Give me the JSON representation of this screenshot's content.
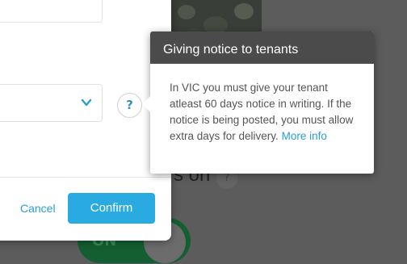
{
  "background": {
    "status_text": "s on",
    "help_glyph": "?",
    "toggle_label": "ON"
  },
  "modal": {
    "help_glyph": "?",
    "chevron_icon": "chevron-down-icon",
    "cancel_label": "Cancel",
    "confirm_label": "Confirm"
  },
  "tooltip": {
    "title": "Giving notice to tenants",
    "body_text": "In VIC you must give your tenant atleast 60 days notice in writing. If the notice is being posted, you must allow extra days for delivery.",
    "more_info_label": "More info"
  },
  "colors": {
    "accent": "#29abe2",
    "link": "#2a9fd6",
    "tooltip_header": "#4b4b4b",
    "overlay": "#5c5c5c",
    "toggle_on": "#155e31"
  }
}
